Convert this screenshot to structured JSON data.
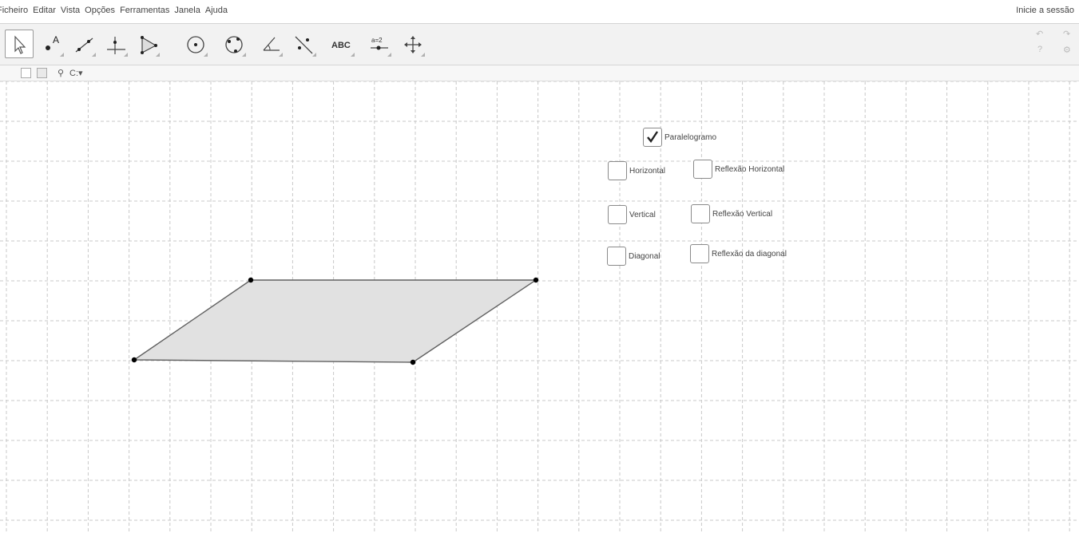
{
  "menu": {
    "items": [
      "Ficheiro",
      "Editar",
      "Vista",
      "Opções",
      "Ferramentas",
      "Janela",
      "Ajuda"
    ],
    "signin": "Inicie a sessão"
  },
  "toolbar": {
    "tools": [
      {
        "name": "move-tool",
        "icon": "arrow-icon"
      },
      {
        "name": "point-tool",
        "icon": "point-A-icon",
        "label": "A"
      },
      {
        "name": "line-tool",
        "icon": "line-icon"
      },
      {
        "name": "perpendicular-tool",
        "icon": "perpendicular-icon"
      },
      {
        "name": "polygon-tool",
        "icon": "polygon-icon"
      },
      {
        "name": "circle-tool",
        "icon": "circle-center-icon"
      },
      {
        "name": "circle-three-points-tool",
        "icon": "circle-points-icon"
      },
      {
        "name": "angle-tool",
        "icon": "angle-icon"
      },
      {
        "name": "reflect-tool",
        "icon": "reflect-icon"
      },
      {
        "name": "text-tool",
        "icon": "text-icon",
        "label": "ABC"
      },
      {
        "name": "slider-tool",
        "icon": "slider-icon",
        "label": "a=2"
      },
      {
        "name": "move-view-tool",
        "icon": "move-view-icon"
      }
    ],
    "undo_label": "↶",
    "redo_label": "↷",
    "help_label": "?",
    "settings_label": "⚙"
  },
  "stylebar": {
    "pin_label": "⚲",
    "dropdown_label": "C:▾"
  },
  "graphics": {
    "checkboxes": [
      {
        "label": "Paralelogramo",
        "checked": true
      },
      {
        "label": "Horizontal",
        "checked": false
      },
      {
        "label": "Reflexão Horizontal",
        "checked": false
      },
      {
        "label": "Vertical",
        "checked": false
      },
      {
        "label": "Reflexão Vertical",
        "checked": false
      },
      {
        "label": "Diagonal",
        "checked": false
      },
      {
        "label": "Reflexão da diagonal",
        "checked": false
      }
    ],
    "colors": {
      "polygon_fill": "#e1e1e1",
      "polygon_stroke": "#616161",
      "point": "#000000",
      "grid": "#c8c8c8"
    }
  }
}
